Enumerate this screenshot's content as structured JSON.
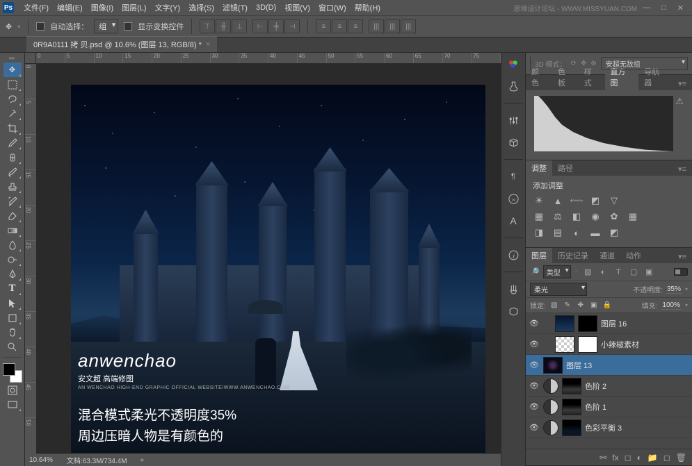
{
  "menubar": {
    "items": [
      "文件(F)",
      "编辑(E)",
      "图像(I)",
      "图层(L)",
      "文字(Y)",
      "选择(S)",
      "滤镜(T)",
      "3D(D)",
      "视图(V)",
      "窗口(W)",
      "帮助(H)"
    ],
    "watermark": "思缘设计论坛 - WWW.MISSYUAN.COM"
  },
  "optbar": {
    "autoselect": "自动选择：",
    "group": "组",
    "transform": "显示变换控件",
    "mode3d_label": "3D 模式：",
    "mode3d_value": "安超无敌组"
  },
  "tab": {
    "title": "0R9A0111 拷 贝.psd @ 10.6% (图层 13, RGB/8) *"
  },
  "rulers": {
    "h": [
      "",
      "0",
      "5",
      "10",
      "15",
      "20",
      "25",
      "30",
      "35",
      "40",
      "45",
      "50",
      "55",
      "60",
      "65",
      "70",
      "75"
    ],
    "v": [
      "0",
      "5",
      "10",
      "15",
      "20",
      "25",
      "30",
      "35",
      "40",
      "45",
      "50"
    ]
  },
  "canvas": {
    "wm_big": "anwenchao",
    "wm_mid": "安文超 高端修图",
    "wm_sm": "AN WENCHAO HIGH-END GRAPHIC OFFICIAL WEBSITE/WWW.ANWENCHAO.COM",
    "anno1": "混合模式柔光不透明度35%",
    "anno2": "周边压暗人物是有颜色的"
  },
  "status": {
    "zoom": "10.64%",
    "doc_label": "文档:",
    "doc_val": "63.3M/734.4M"
  },
  "panels": {
    "p3d": {
      "label": "3D 模式：",
      "value": "安超无敌组"
    },
    "histogram": {
      "tabs": [
        "颜色",
        "色板",
        "样式",
        "直方图",
        "导航器"
      ],
      "active": 3,
      "warn": "⚠"
    },
    "adjust": {
      "tabs": [
        "调整",
        "路径"
      ],
      "title": "添加调整"
    },
    "layers": {
      "tabs": [
        "图层",
        "历史记录",
        "通道",
        "动作"
      ],
      "filter": {
        "kind": "类型",
        "search": "🔍"
      },
      "blend": "柔光",
      "opacity_label": "不透明度:",
      "opacity_value": "35%",
      "lock_label": "锁定:",
      "fill_label": "填充:",
      "fill_value": "100%",
      "items": [
        {
          "name": "图层 16",
          "thumb": "night",
          "mask": "dark",
          "eye": true,
          "indent": true
        },
        {
          "name": "小辣椒素材",
          "thumb": "trans",
          "mask": "white",
          "eye": true,
          "indent": true
        },
        {
          "name": "图层 13",
          "thumb": "dark",
          "eye": true,
          "sel": true
        },
        {
          "name": "色阶 2",
          "adj": true,
          "mask": "grad",
          "eye": true
        },
        {
          "name": "色阶 1",
          "adj": true,
          "mask": "grad",
          "eye": true
        },
        {
          "name": "色彩平衡 3",
          "adj": true,
          "mask": "cb",
          "eye": true
        }
      ]
    }
  }
}
